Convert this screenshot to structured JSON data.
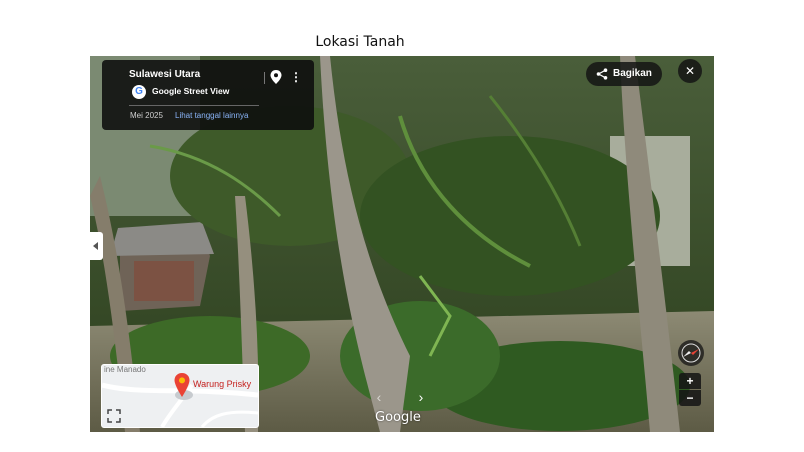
{
  "slide": {
    "title": "Lokasi Tanah"
  },
  "info_card": {
    "place": "Sulawesi Utara",
    "product": "Google Street View",
    "g_letter": "G",
    "date": "Mei 2025",
    "more_dates_link": "Lihat tanggal lainnya",
    "more_menu_glyph": "⋮"
  },
  "toolbar": {
    "share_label": "Bagikan",
    "close_glyph": "✕"
  },
  "minimap": {
    "city_label": "ine Manado",
    "place_label": "Warung Prisky"
  },
  "controls": {
    "zoom_in": "+",
    "zoom_out": "−",
    "nav_left": "‹",
    "nav_right": "›"
  },
  "brand": {
    "label": "Google"
  },
  "icons": [
    "map-pin-icon",
    "more-vert-icon",
    "share-icon",
    "close-icon",
    "chevron-left-icon",
    "expand-icon",
    "compass-icon"
  ],
  "colors": {
    "card_bg": "#0c0c0c",
    "link": "#8ab4f8",
    "pin_red": "#ea4335",
    "foliage": "#3f5a2a"
  }
}
